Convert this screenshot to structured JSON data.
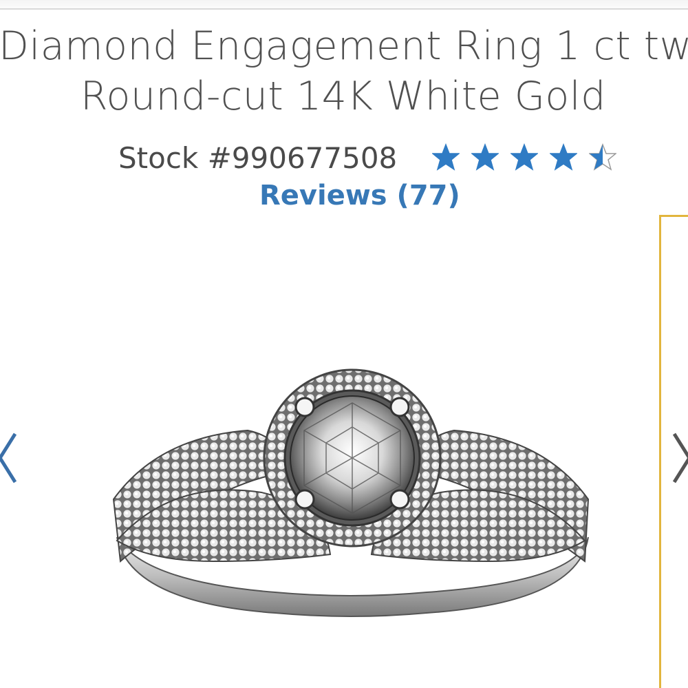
{
  "product": {
    "title_line1": "Diamond Engagement Ring 1 ct tw",
    "title_line2": "Round-cut 14K White Gold",
    "stock": "Stock #990677508",
    "rating": 4.5,
    "rating_max": 5,
    "reviews_link": "Reviews (77)"
  },
  "gallery": {
    "image_alt": "diamond-engagement-ring-image",
    "prev_icon": "chevron-left-icon",
    "next_icon": "chevron-right-icon"
  },
  "colors": {
    "star": "#2f7bc4",
    "link": "#3778b6",
    "accent_border": "#e2b53d",
    "arrow": "#3a6fa8"
  }
}
